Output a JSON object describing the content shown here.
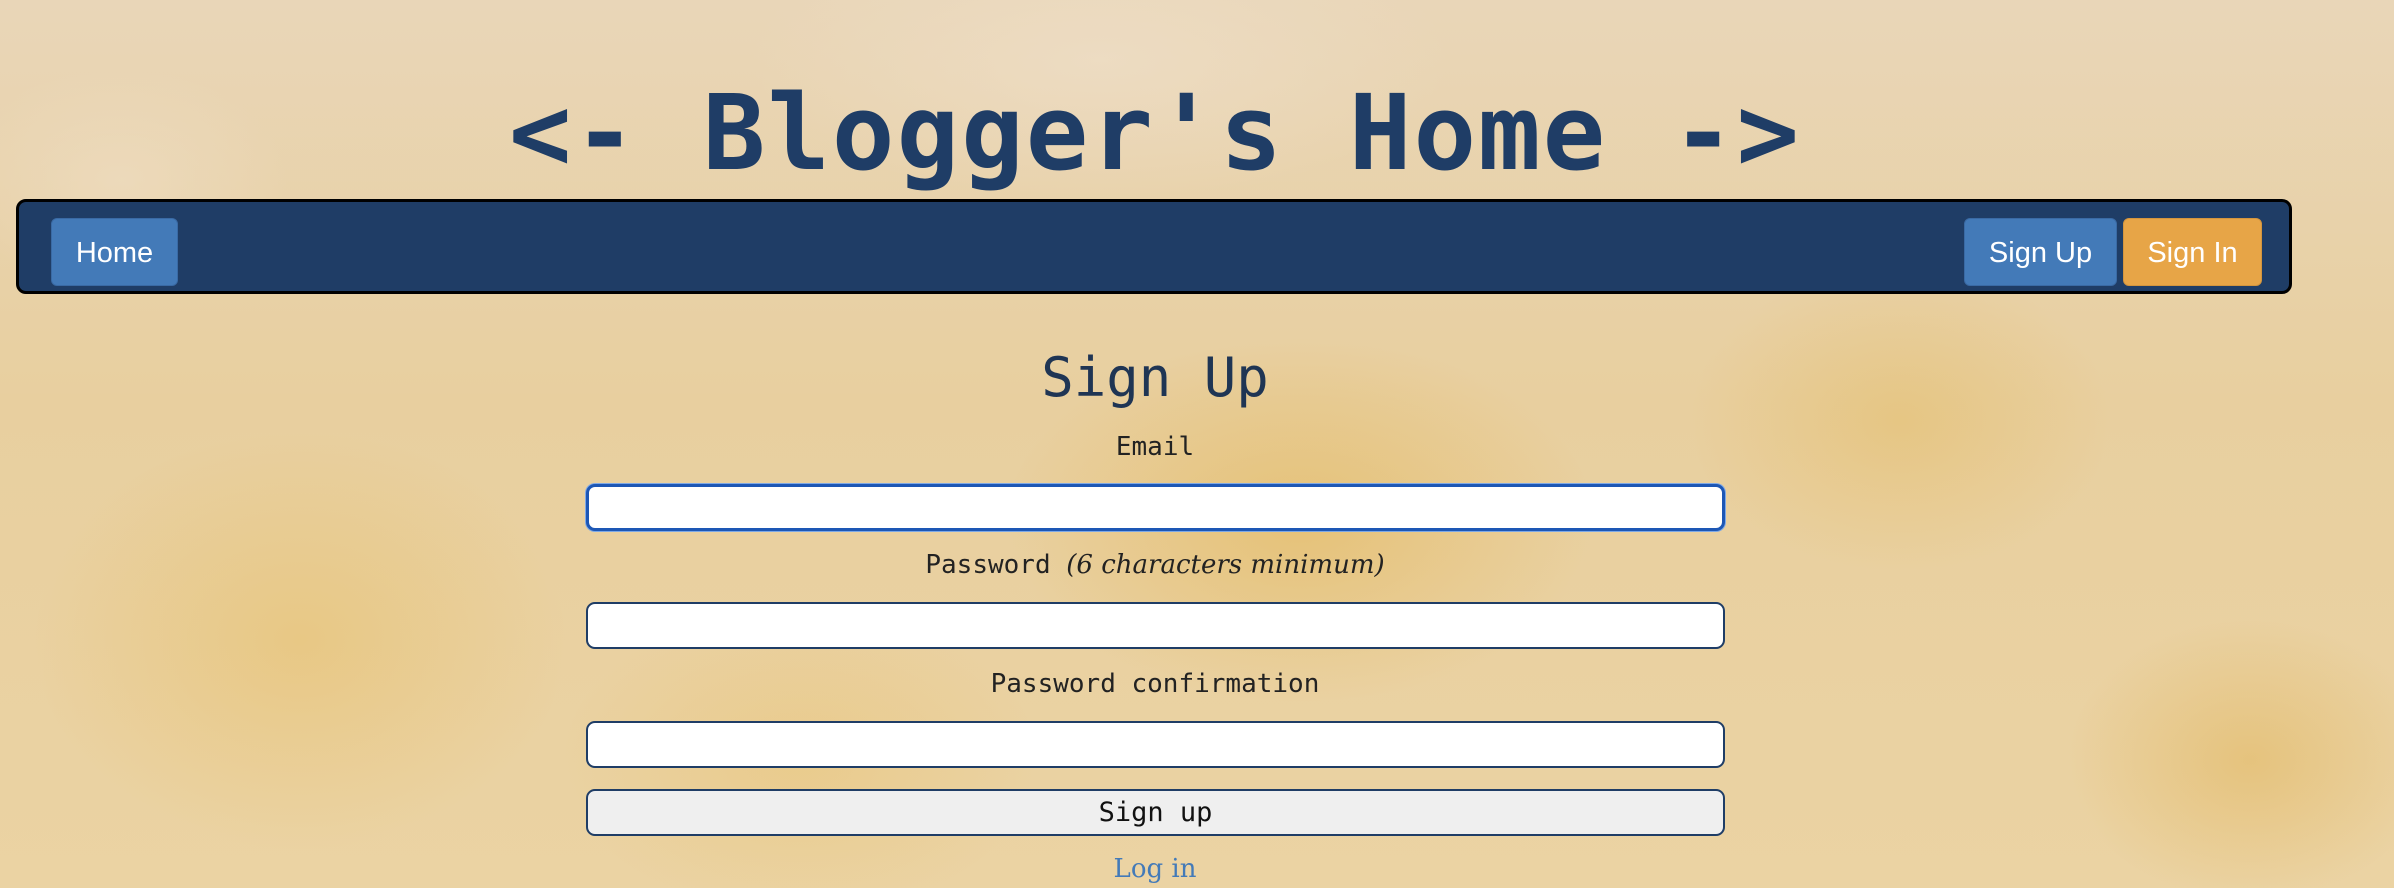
{
  "header": {
    "title": "<- Blogger's Home ->"
  },
  "navbar": {
    "home_label": "Home",
    "signup_label": "Sign Up",
    "signin_label": "Sign In"
  },
  "form": {
    "title": "Sign Up",
    "email_label": "Email",
    "email_value": "",
    "password_label": "Password",
    "password_hint": "(6 characters minimum)",
    "password_value": "",
    "confirm_label": "Password confirmation",
    "confirm_value": "",
    "submit_label": "Sign up",
    "login_link": "Log in"
  },
  "colors": {
    "navbar_bg": "#1f3d66",
    "primary_button": "#437ab8",
    "accent_button": "#e7a547",
    "title_text": "#1f3d66",
    "link": "#437ab8"
  }
}
